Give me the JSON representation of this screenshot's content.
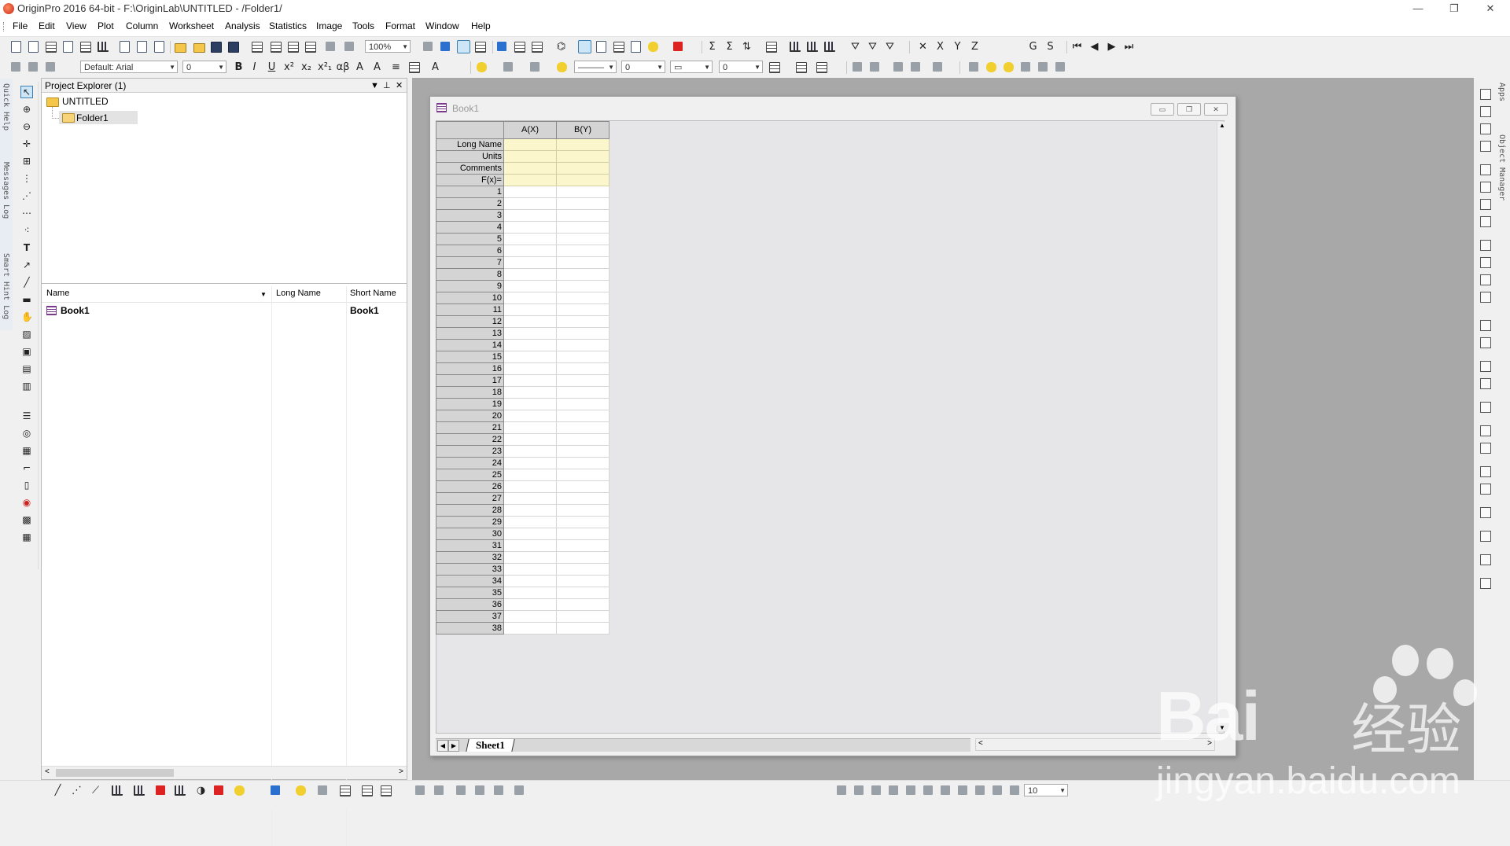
{
  "window": {
    "title": "OriginPro 2016 64-bit - F:\\OriginLab\\UNTITLED - /Folder1/",
    "minimize_glyph": "—",
    "restore_glyph": "❐",
    "close_glyph": "✕"
  },
  "menu": [
    "File",
    "Edit",
    "View",
    "Plot",
    "Column",
    "Worksheet",
    "Analysis",
    "Statistics",
    "Image",
    "Tools",
    "Format",
    "Window",
    "Help"
  ],
  "toolbar": {
    "zoom": "100%",
    "font": "Default: Arial",
    "font_size": "0",
    "line_width": "0",
    "border_width": "0",
    "bold": "B",
    "italic": "I",
    "underline": "U",
    "greek": "αβ",
    "label_x": "X",
    "label_y": "Y",
    "label_z": "Z",
    "label_g": "G",
    "label_s": "S"
  },
  "side_tabs": {
    "quick_help": "Quick Help",
    "messages_log": "Messages Log",
    "smart_hint_log": "Smart Hint Log",
    "apps": "Apps",
    "object_manager": "Object Manager"
  },
  "project_explorer": {
    "title": "Project Explorer (1)",
    "root": "UNTITLED",
    "folder": "Folder1",
    "columns": [
      "Name",
      "Long Name",
      "Short Name"
    ],
    "items": [
      {
        "name": "Book1",
        "long_name": "",
        "short_name": "Book1"
      }
    ]
  },
  "workbook": {
    "title": "Book1",
    "columns": [
      "A(X)",
      "B(Y)"
    ],
    "label_rows": [
      "Long Name",
      "Units",
      "Comments",
      "F(x)="
    ],
    "row_count": 38,
    "sheet_tab": "Sheet1"
  },
  "bottom": {
    "zoom_value": "10"
  },
  "watermark": {
    "brand": "Bai",
    "brand_cn": "经验",
    "url": "jingyan.baidu.com"
  }
}
